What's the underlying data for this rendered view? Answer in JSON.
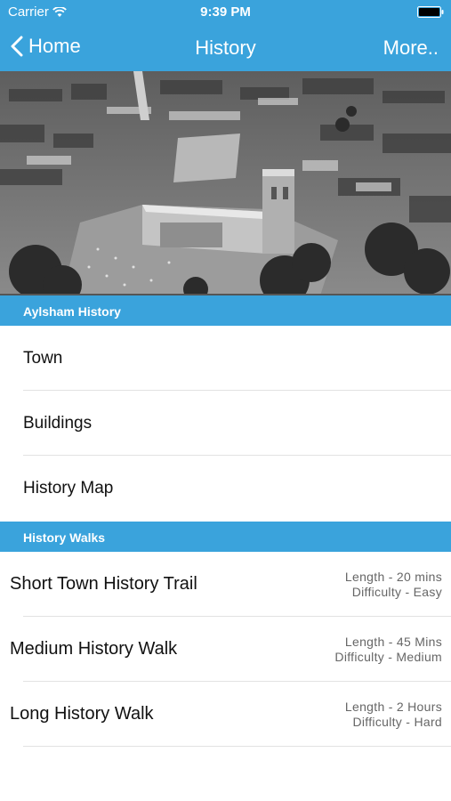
{
  "status_bar": {
    "carrier": "Carrier",
    "time": "9:39 PM"
  },
  "nav": {
    "back_label": "Home",
    "title": "History",
    "more_label": "More.."
  },
  "sections": [
    {
      "header": "Aylsham History",
      "items": [
        "Town",
        "Buildings",
        "History Map"
      ]
    },
    {
      "header": "History Walks"
    }
  ],
  "walks": [
    {
      "name": "Short Town History Trail",
      "length": "Length - 20 mins",
      "difficulty": "Difficulty - Easy"
    },
    {
      "name": "Medium History Walk",
      "length": "Length - 45 Mins",
      "difficulty": "Difficulty - Medium"
    },
    {
      "name": "Long History Walk",
      "length": "Length - 2 Hours",
      "difficulty": "Difficulty - Hard"
    }
  ],
  "colors": {
    "accent": "#3aa3dc",
    "separator": "#e2e2e2",
    "meta_text": "#666666"
  }
}
